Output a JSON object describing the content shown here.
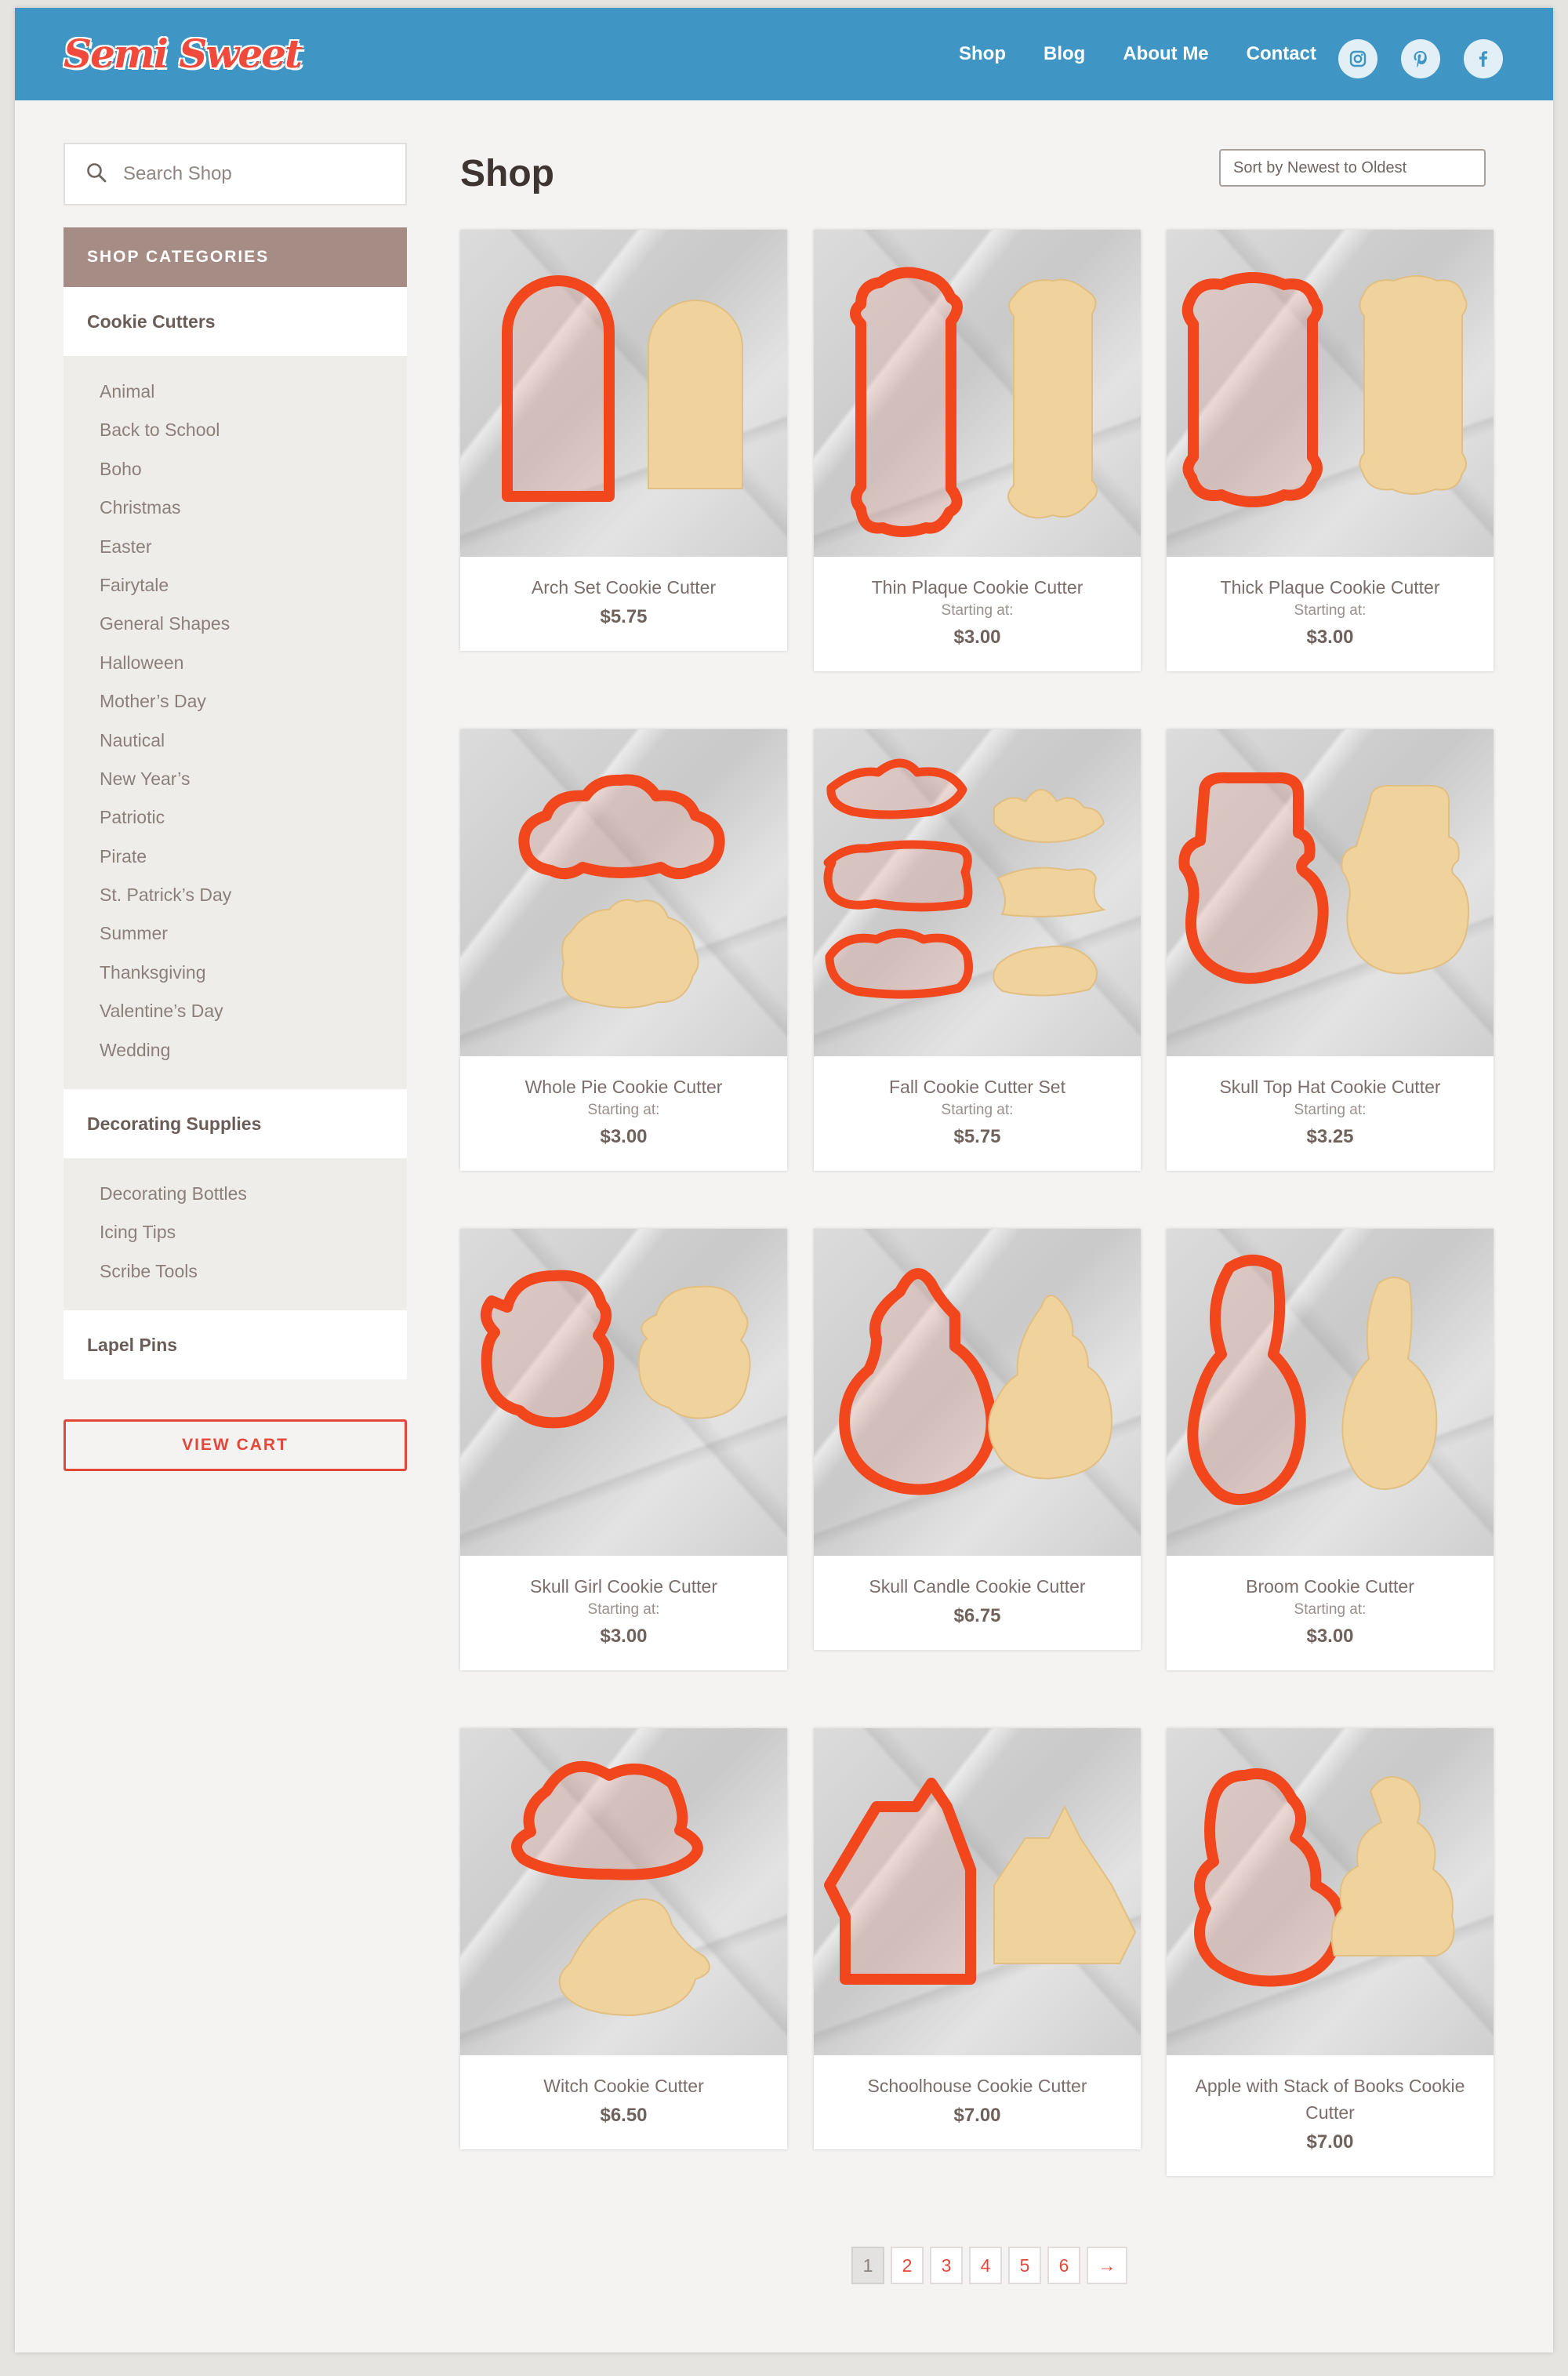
{
  "header": {
    "logo_text": "Semi Sweet",
    "nav": [
      "Shop",
      "Blog",
      "About Me",
      "Contact"
    ],
    "social": [
      "instagram-icon",
      "pinterest-icon",
      "facebook-icon"
    ],
    "brand_color": "#3f96c4",
    "accent_color": "#ef4a3b"
  },
  "sidebar": {
    "search_placeholder": "Search Shop",
    "categories_title": "SHOP CATEGORIES",
    "groups": [
      {
        "title": "Cookie Cutters",
        "items": [
          "Animal",
          "Back to School",
          "Boho",
          "Christmas",
          "Easter",
          "Fairytale",
          "General Shapes",
          "Halloween",
          "Mother’s Day",
          "Nautical",
          "New Year’s",
          "Patriotic",
          "Pirate",
          "St. Patrick’s Day",
          "Summer",
          "Thanksgiving",
          "Valentine’s Day",
          "Wedding"
        ]
      },
      {
        "title": "Decorating Supplies",
        "items": [
          "Decorating Bottles",
          "Icing Tips",
          "Scribe Tools"
        ]
      },
      {
        "title": "Lapel Pins",
        "items": []
      }
    ],
    "view_cart": "VIEW CART"
  },
  "main": {
    "title": "Shop",
    "sort_label": "Sort by Newest to Oldest",
    "products": [
      {
        "name": "Arch Set Cookie Cutter",
        "starting": "",
        "price": "$5.75",
        "shape": "arch"
      },
      {
        "name": "Thin Plaque Cookie Cutter",
        "starting": "Starting at:",
        "price": "$3.00",
        "shape": "plaque-thin"
      },
      {
        "name": "Thick Plaque Cookie Cutter",
        "starting": "Starting at:",
        "price": "$3.00",
        "shape": "plaque-thick"
      },
      {
        "name": "Whole Pie Cookie Cutter",
        "starting": "Starting at:",
        "price": "$3.00",
        "shape": "pie"
      },
      {
        "name": "Fall Cookie Cutter Set",
        "starting": "Starting at:",
        "price": "$5.75",
        "shape": "fall-set"
      },
      {
        "name": "Skull Top Hat Cookie Cutter",
        "starting": "Starting at:",
        "price": "$3.25",
        "shape": "skull-hat"
      },
      {
        "name": "Skull Girl Cookie Cutter",
        "starting": "Starting at:",
        "price": "$3.00",
        "shape": "skull-girl"
      },
      {
        "name": "Skull Candle Cookie Cutter",
        "starting": "",
        "price": "$6.75",
        "shape": "candle"
      },
      {
        "name": "Broom Cookie Cutter",
        "starting": "Starting at:",
        "price": "$3.00",
        "shape": "broom"
      },
      {
        "name": "Witch Cookie Cutter",
        "starting": "",
        "price": "$6.50",
        "shape": "witch"
      },
      {
        "name": "Schoolhouse Cookie Cutter",
        "starting": "",
        "price": "$7.00",
        "shape": "schoolhouse"
      },
      {
        "name": "Apple with Stack of Books Cookie Cutter",
        "starting": "",
        "price": "$7.00",
        "shape": "apple-books"
      }
    ]
  },
  "pagination": {
    "pages": [
      "1",
      "2",
      "3",
      "4",
      "5",
      "6"
    ],
    "current": "1",
    "next": "→"
  }
}
